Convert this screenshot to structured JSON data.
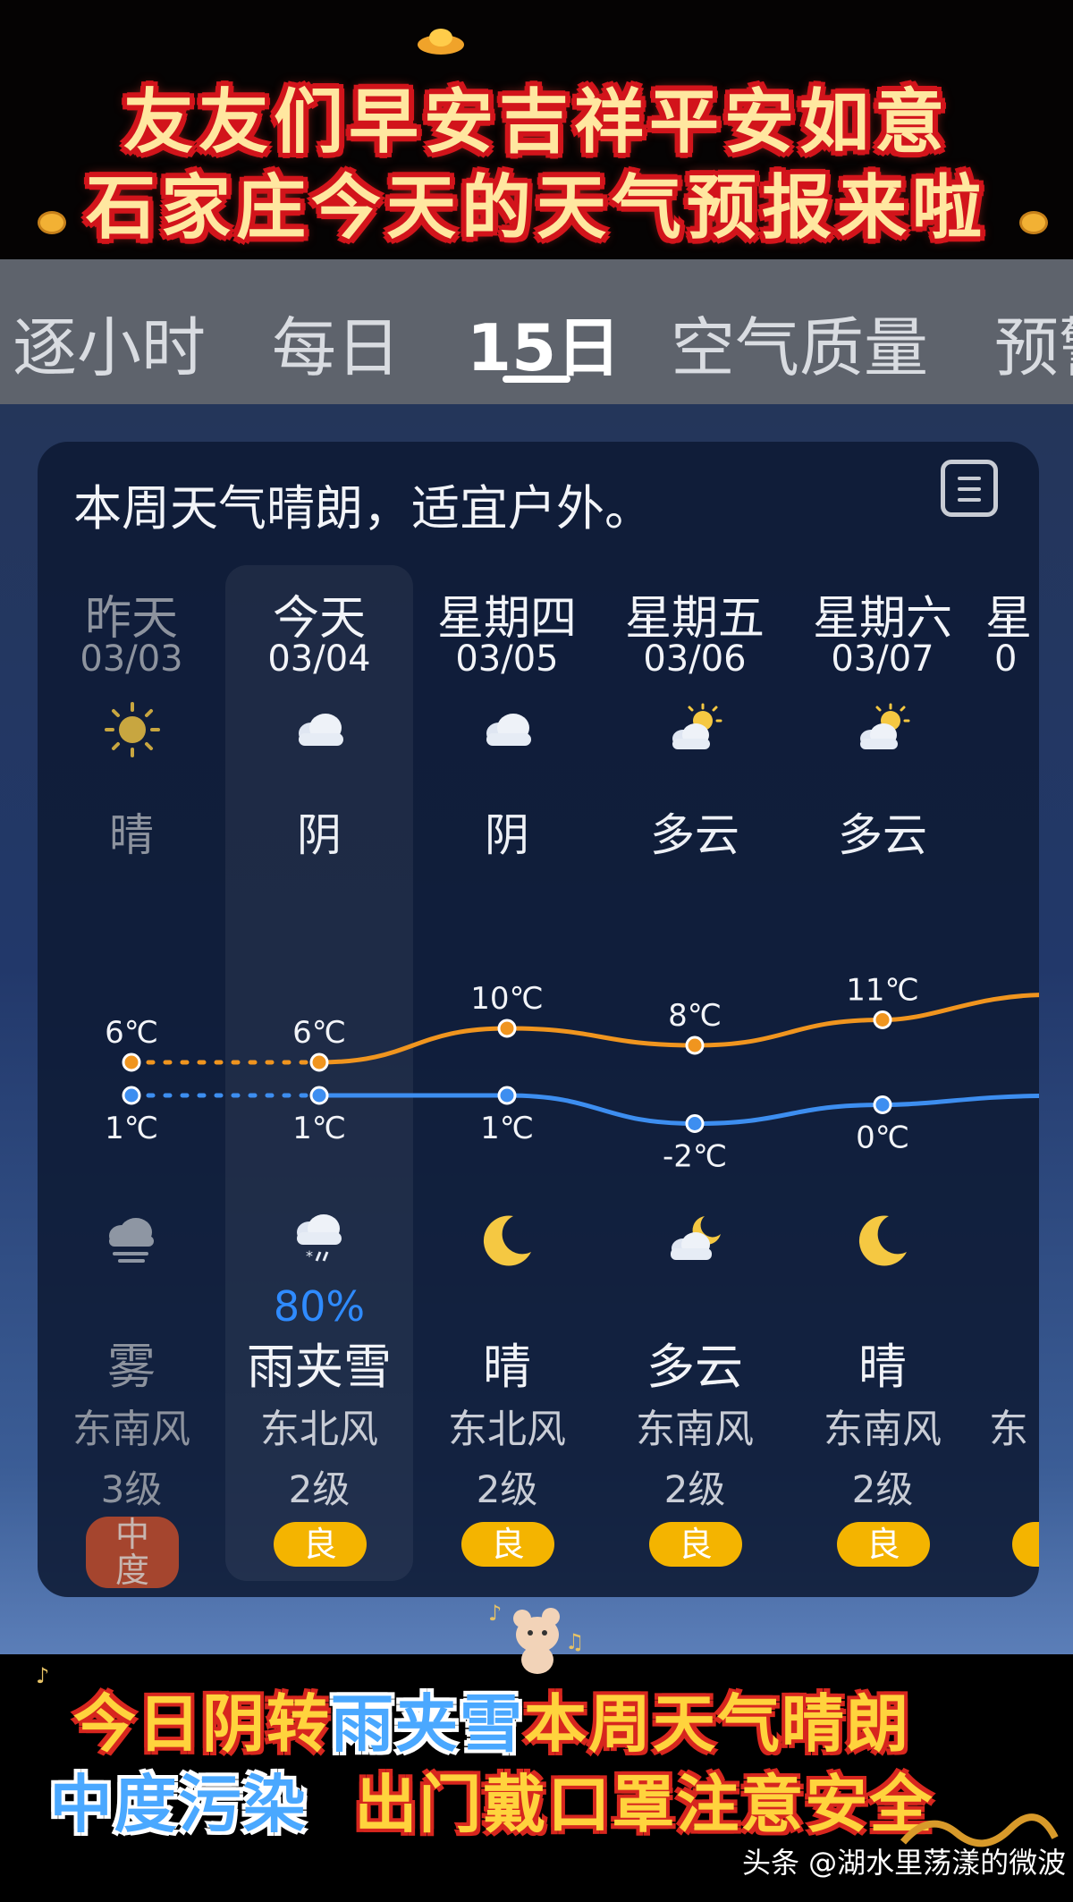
{
  "banner": {
    "line1": "友友们早安吉祥平安如意",
    "line2": "石家庄今天的天气预报来啦"
  },
  "tabs": [
    {
      "label": "逐小时"
    },
    {
      "label": "每日"
    },
    {
      "label": "15日",
      "active": true
    },
    {
      "label": "空气质量"
    },
    {
      "label": "预警"
    }
  ],
  "card": {
    "summary": "本周天气晴朗，适宜户外。",
    "menu_icon": "list-icon"
  },
  "days": [
    {
      "name": "昨天",
      "date": "03/03",
      "day_icon": "sun-icon",
      "day_cond": "晴",
      "high": "6℃",
      "low": "1℃",
      "night_icon": "fog-icon",
      "precip": "",
      "night_cond": "雾",
      "wind_dir": "东南风",
      "wind_level": "3级",
      "aqi": "中度"
    },
    {
      "name": "今天",
      "date": "03/04",
      "day_icon": "cloud-icon",
      "day_cond": "阴",
      "high": "6℃",
      "low": "1℃",
      "night_icon": "sleet-icon",
      "precip": "80%",
      "night_cond": "雨夹雪",
      "wind_dir": "东北风",
      "wind_level": "2级",
      "aqi": "良"
    },
    {
      "name": "星期四",
      "date": "03/05",
      "day_icon": "cloud-icon",
      "day_cond": "阴",
      "high": "10℃",
      "low": "1℃",
      "night_icon": "moon-icon",
      "precip": "",
      "night_cond": "晴",
      "wind_dir": "东北风",
      "wind_level": "2级",
      "aqi": "良"
    },
    {
      "name": "星期五",
      "date": "03/06",
      "day_icon": "partly-cloudy-icon",
      "day_cond": "多云",
      "high": "8℃",
      "low": "-2℃",
      "night_icon": "cloudy-night-icon",
      "precip": "",
      "night_cond": "多云",
      "wind_dir": "东南风",
      "wind_level": "2级",
      "aqi": "良"
    },
    {
      "name": "星期六",
      "date": "03/07",
      "day_icon": "partly-cloudy-icon",
      "day_cond": "多云",
      "high": "11℃",
      "low": "0℃",
      "night_icon": "moon-icon",
      "precip": "",
      "night_cond": "晴",
      "wind_dir": "东南风",
      "wind_level": "2级",
      "aqi": "良"
    },
    {
      "name": "星",
      "date": "0",
      "wind_dir": "东"
    }
  ],
  "temps": {
    "high": [
      6,
      6,
      10,
      8,
      11
    ],
    "low": [
      1,
      1,
      1,
      -2,
      0
    ]
  },
  "colors": {
    "high_line": "#f0951f",
    "low_line": "#3d8ef0",
    "aqi_good": "#f4b400",
    "aqi_moderate": "#a5452e",
    "precip": "#2f8bff"
  },
  "bottom": {
    "line1_a": "今日阴转",
    "line1_b": "雨夹雪",
    "line1_c": "本周天气晴朗",
    "line2_a": "中度污染",
    "line2_b": "出门戴口罩注意安全"
  },
  "watermark": "头条 @湖水里荡漾的微波"
}
